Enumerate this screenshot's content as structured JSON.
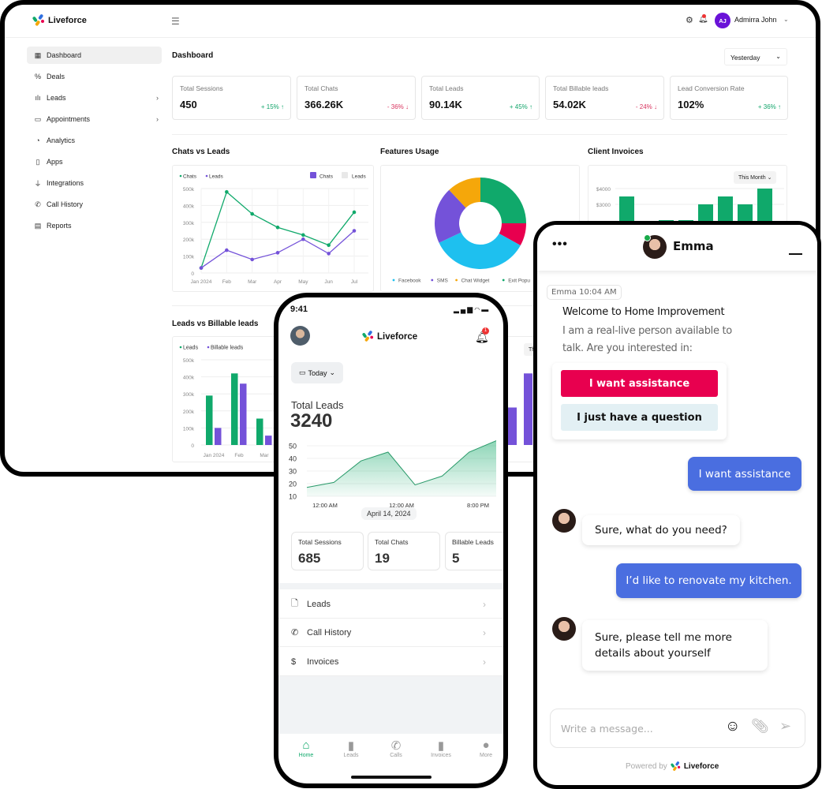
{
  "colors": {
    "green": "#10a96b",
    "purple": "#7452d9",
    "cyan": "#1ec0ef",
    "orange": "#f5a70a",
    "red": "#e8004f",
    "blue": "#4a6ee0"
  },
  "app": {
    "brand": "Liveforce",
    "menu_icon": "hamburger-icon"
  },
  "header": {
    "user_initials": "AJ",
    "user_name": "Admirra John",
    "icons": [
      "gear-icon",
      "bell-icon"
    ]
  },
  "sidebar": {
    "items": [
      {
        "label": "Dashboard",
        "icon": "grid-icon",
        "active": true
      },
      {
        "label": "Deals",
        "icon": "percent-icon"
      },
      {
        "label": "Leads",
        "icon": "bar-chart-icon",
        "has_submenu": true
      },
      {
        "label": "Appointments",
        "icon": "calendar-icon",
        "has_submenu": true
      },
      {
        "label": "Analytics",
        "icon": "pie-icon"
      },
      {
        "label": "Apps",
        "icon": "phone-icon"
      },
      {
        "label": "Integrations",
        "icon": "plug-icon"
      },
      {
        "label": "Call History",
        "icon": "call-icon"
      },
      {
        "label": "Reports",
        "icon": "report-icon"
      }
    ]
  },
  "dashboard": {
    "title": "Dashboard",
    "period": "Yesterday",
    "stats": [
      {
        "label": "Total Sessions",
        "value": "450",
        "change": "+ 15% ↑",
        "trend": "up"
      },
      {
        "label": "Total Chats",
        "value": "366.26K",
        "change": "- 36% ↓",
        "trend": "down"
      },
      {
        "label": "Total Leads",
        "value": "90.14K",
        "change": "+ 45% ↑",
        "trend": "up"
      },
      {
        "label": "Total Billable leads",
        "value": "54.02K",
        "change": "- 24% ↓",
        "trend": "down"
      },
      {
        "label": "Lead Conversion Rate",
        "value": "102%",
        "change": "+ 36% ↑",
        "trend": "up"
      }
    ],
    "this_month": "This Month"
  },
  "chart_data": [
    {
      "id": "chats_vs_leads",
      "type": "line",
      "title": "Chats vs Leads",
      "categories": [
        "Jan 2024",
        "Feb",
        "Mar",
        "Apr",
        "May",
        "Jun",
        "Jul"
      ],
      "yticks": [
        "0",
        "100k",
        "200k",
        "300k",
        "400k",
        "500k"
      ],
      "ylim": [
        0,
        500
      ],
      "legend": [
        "Chats",
        "Leads"
      ],
      "toggles": [
        "Chats",
        "Leads"
      ],
      "series": [
        {
          "name": "Chats",
          "values": [
            30,
            480,
            350,
            270,
            225,
            165,
            360
          ]
        },
        {
          "name": "Leads",
          "values": [
            30,
            135,
            80,
            120,
            200,
            115,
            250
          ]
        }
      ],
      "grid": true,
      "legend_position": "top-left"
    },
    {
      "id": "features_usage",
      "type": "pie",
      "title": "Features Usage",
      "donut": true,
      "slices": [
        {
          "name": "Exit Popup",
          "value": 25,
          "color": "#10a96b"
        },
        {
          "name": "",
          "value": 8,
          "color": "#e8004f"
        },
        {
          "name": "Facebook",
          "value": 35,
          "color": "#1ec0ef"
        },
        {
          "name": "SMS",
          "value": 20,
          "color": "#7452d9"
        },
        {
          "name": "Chat Widget",
          "value": 12,
          "color": "#f5a70a"
        }
      ],
      "legend": [
        "Facebook",
        "SMS",
        "Chat Widget",
        "Exit Popu"
      ],
      "legend_position": "bottom"
    },
    {
      "id": "client_invoices",
      "type": "bar",
      "title": "Client Invoices",
      "yticks": [
        "$4000",
        "$3000"
      ],
      "values": [
        3500,
        null,
        2000,
        2000,
        3000,
        3500,
        3000,
        4000
      ]
    },
    {
      "id": "leads_vs_billable",
      "type": "bar",
      "title": "Leads vs Billable leads",
      "categories": [
        "Jan 2024",
        "Feb",
        "Mar"
      ],
      "yticks": [
        "0",
        "100k",
        "200k",
        "300k",
        "400k",
        "500k"
      ],
      "ylim": [
        0,
        500
      ],
      "legend": [
        "Leads",
        "Billable leads"
      ],
      "series": [
        {
          "name": "Leads",
          "values": [
            290,
            420,
            155
          ]
        },
        {
          "name": "Billable leads",
          "values": [
            100,
            360,
            55
          ]
        }
      ]
    },
    {
      "id": "right_bottom_chart",
      "type": "bar",
      "values": [
        220,
        420
      ]
    },
    {
      "id": "phone_total_leads",
      "type": "area",
      "xticks": [
        "12:00 AM",
        "12:00 AM",
        "8:00 PM"
      ],
      "yticks": [
        "10",
        "20",
        "30",
        "40",
        "50"
      ],
      "ylim": [
        10,
        50
      ],
      "values": [
        17,
        21,
        38,
        45,
        19,
        26,
        45,
        54
      ]
    }
  ],
  "phone": {
    "time": "9:41",
    "brand": "Liveforce",
    "notif_count": "1",
    "range": "Today",
    "kpi_label": "Total Leads",
    "kpi_value": "3240",
    "date": "April 14, 2024",
    "stats": [
      {
        "label": "Total Sessions",
        "value": "685"
      },
      {
        "label": "Total Chats",
        "value": "19"
      },
      {
        "label": "Billable Leads",
        "value": "5"
      }
    ],
    "menu": [
      {
        "label": "Leads",
        "icon": "document-icon"
      },
      {
        "label": "Call History",
        "icon": "call-icon"
      },
      {
        "label": "Invoices",
        "icon": "invoice-icon"
      }
    ],
    "nav": [
      {
        "label": "Home",
        "active": true
      },
      {
        "label": "Leads"
      },
      {
        "label": "Calls"
      },
      {
        "label": "Invoices"
      },
      {
        "label": "More"
      }
    ]
  },
  "chat": {
    "agent": "Emma",
    "timestamp": "Emma 10:04 AM",
    "welcome_title": "Welcome to Home Improvement",
    "welcome_body": "I am a real-live person available to talk. Are you interested in:",
    "options": [
      "I want assistance",
      "I just have a question"
    ],
    "messages": [
      {
        "from": "user",
        "text": "I want assistance"
      },
      {
        "from": "agent",
        "text": "Sure, what do you need?"
      },
      {
        "from": "user",
        "text": "I’d like to renovate my kitchen."
      },
      {
        "from": "agent",
        "text": "Sure, please tell me more details about yourself"
      }
    ],
    "input_placeholder": "Write a message...",
    "powered_by": "Powered by",
    "brand": "Liveforce"
  }
}
